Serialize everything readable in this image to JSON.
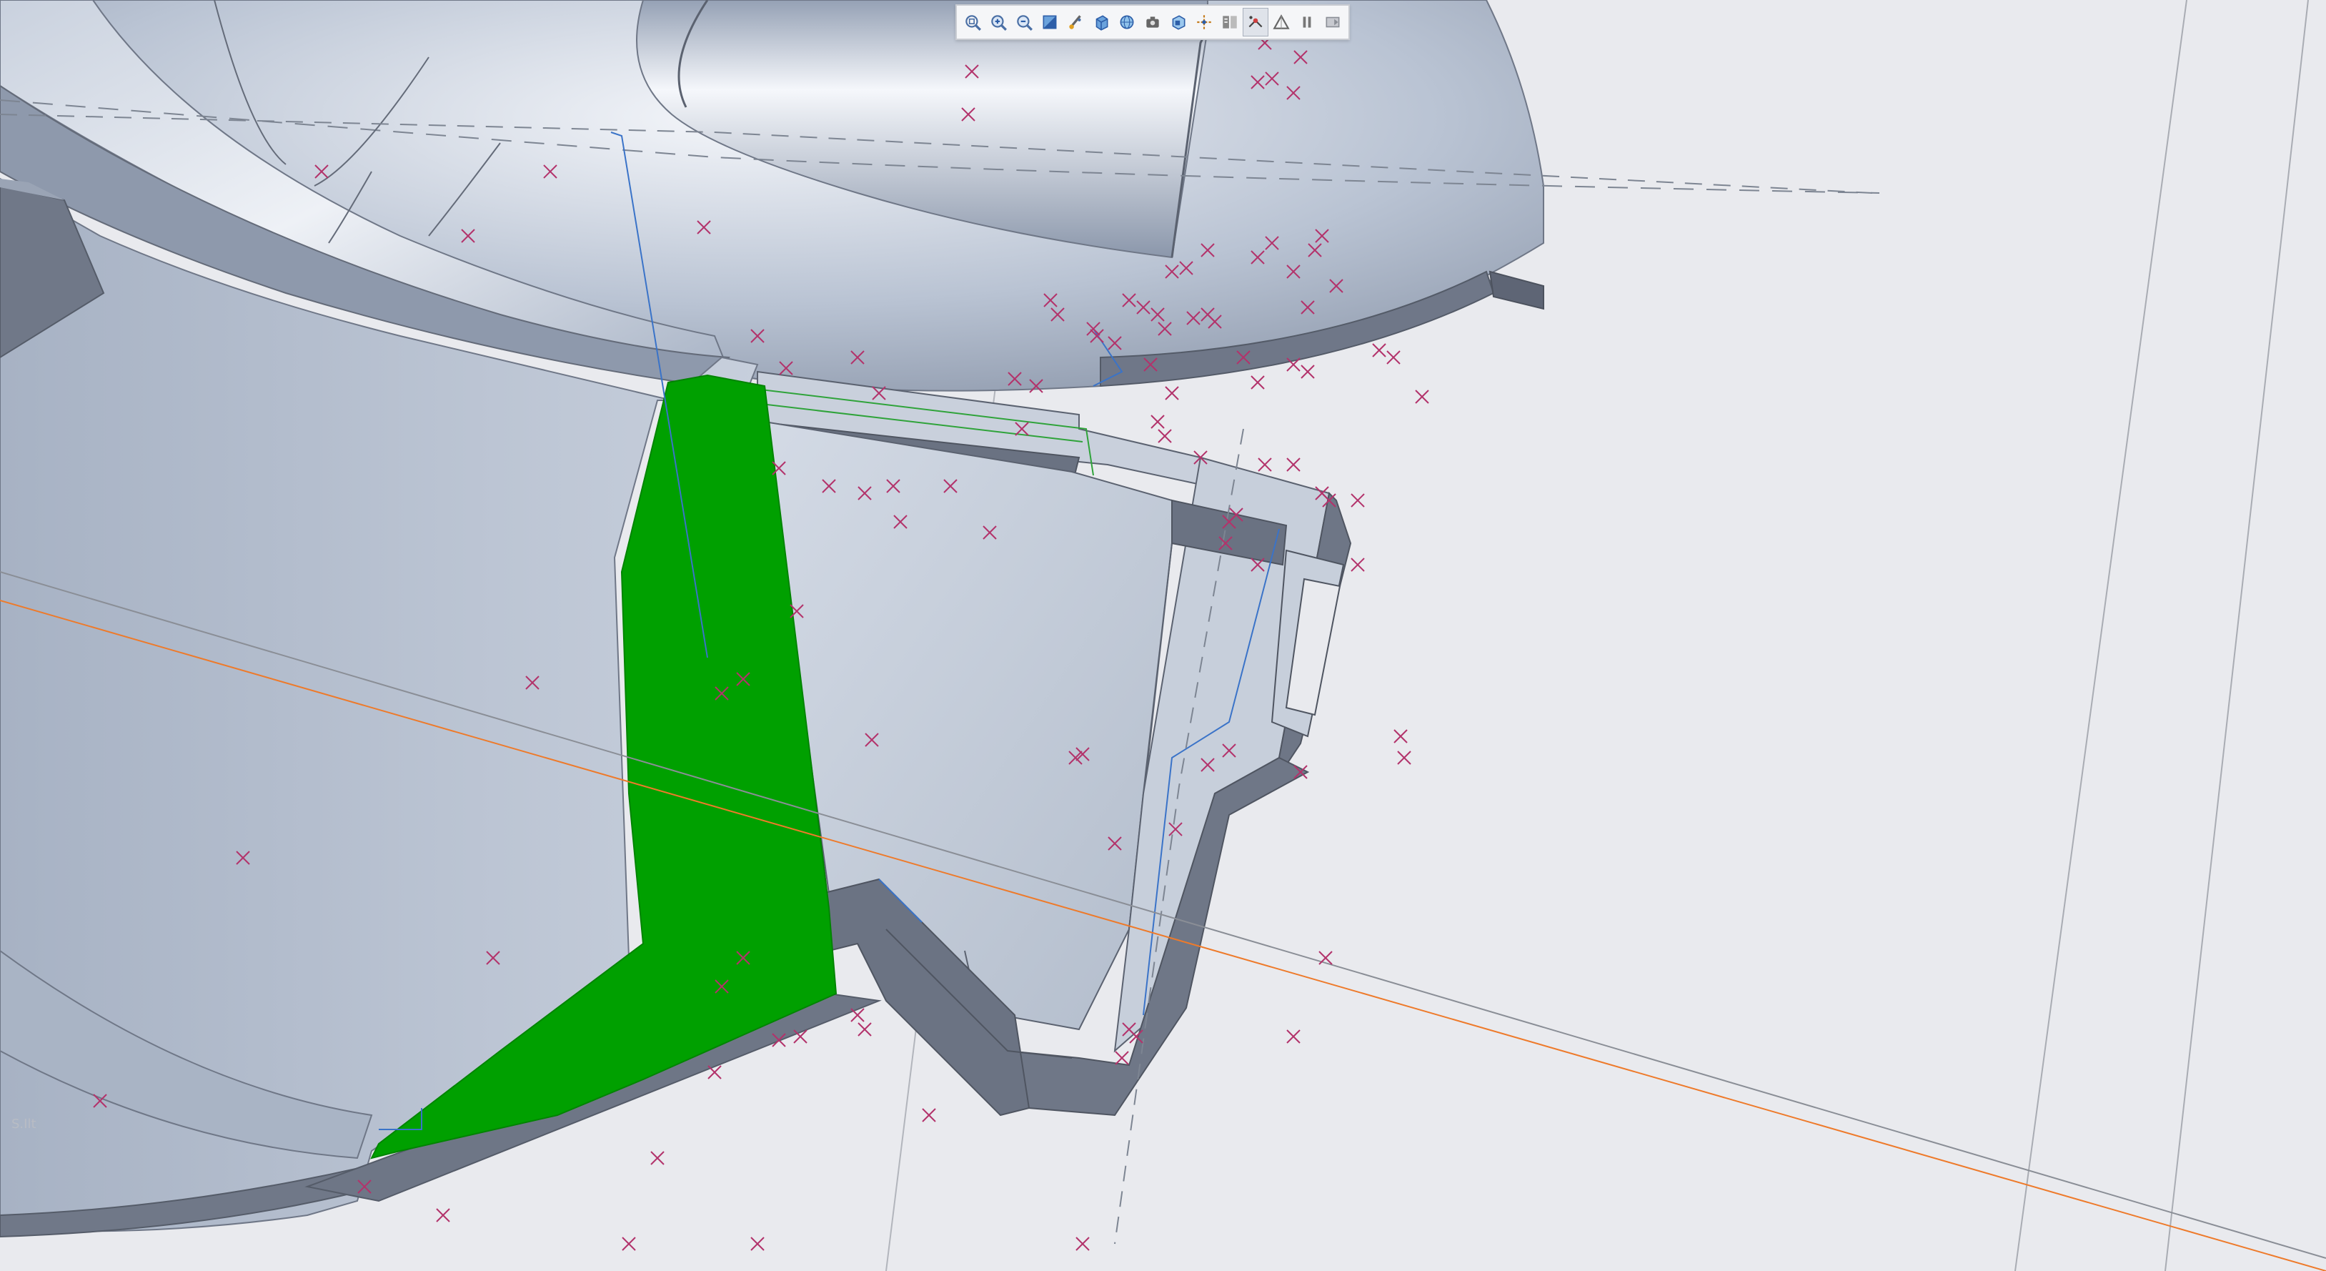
{
  "toolbar": {
    "buttons": [
      {
        "name": "zoom-fit-icon",
        "icon": "magnifier-fit"
      },
      {
        "name": "zoom-in-icon",
        "icon": "magnifier-plus"
      },
      {
        "name": "zoom-out-icon",
        "icon": "magnifier-minus"
      },
      {
        "name": "section-view-icon",
        "icon": "section"
      },
      {
        "name": "appearance-icon",
        "icon": "brush"
      },
      {
        "name": "display-style-icon",
        "icon": "cube-shaded"
      },
      {
        "name": "view-manager-icon",
        "icon": "globe"
      },
      {
        "name": "saved-views-icon",
        "icon": "camera"
      },
      {
        "name": "named-views-icon",
        "icon": "cube-faces"
      },
      {
        "name": "datum-display-icon",
        "icon": "datum-axes"
      },
      {
        "name": "annotation-display-icon",
        "icon": "annotations"
      },
      {
        "name": "spin-center-icon",
        "icon": "spin-center",
        "active": true
      },
      {
        "name": "perspective-icon",
        "icon": "triangle"
      },
      {
        "name": "pause-icon",
        "icon": "pause"
      },
      {
        "name": "repaint-icon",
        "icon": "repaint"
      }
    ]
  },
  "colors": {
    "background": "#e9eaee",
    "selection": "#00a000",
    "model_face": "#b6c1d2",
    "model_edge": "#7d8594",
    "datum_point": "#b3336b",
    "datum_axis": "#ee7a2a",
    "sketch_line": "#3a73c8"
  },
  "viewport": {
    "corner_text": "S.Ilt"
  }
}
